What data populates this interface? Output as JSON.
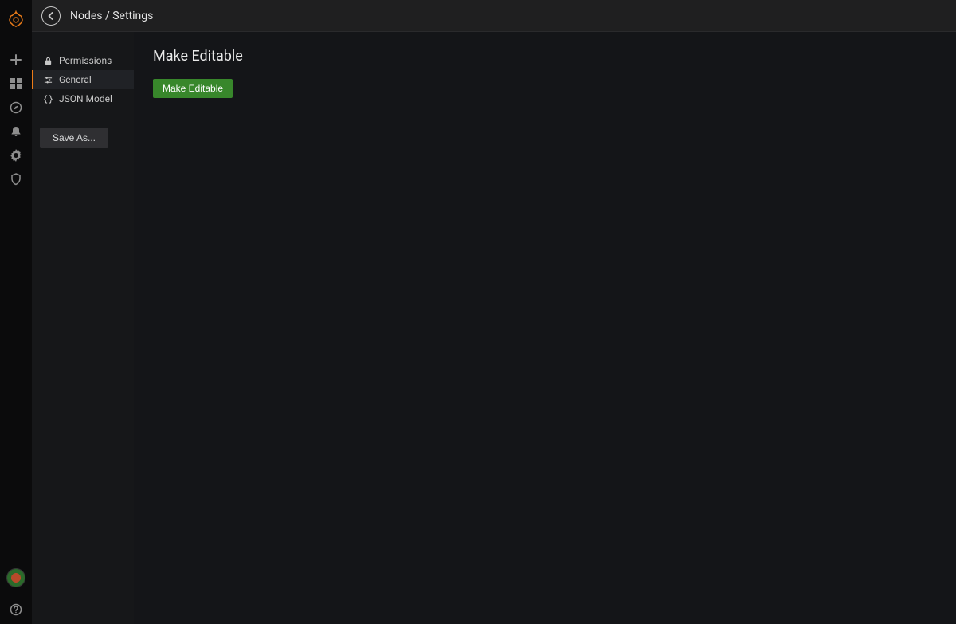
{
  "breadcrumb": "Nodes / Settings",
  "rail": {
    "items": [
      "plus",
      "dashboards",
      "explore",
      "alerting",
      "configuration",
      "admin"
    ]
  },
  "settings": {
    "items": [
      {
        "icon": "lock",
        "label": "Permissions"
      },
      {
        "icon": "sliders",
        "label": "General"
      },
      {
        "icon": "json",
        "label": "JSON Model"
      }
    ],
    "active_index": 1,
    "save_as_label": "Save As..."
  },
  "content": {
    "title": "Make Editable",
    "button_label": "Make Editable"
  },
  "colors": {
    "accent": "#eb7b18",
    "primary": "#38872b"
  }
}
